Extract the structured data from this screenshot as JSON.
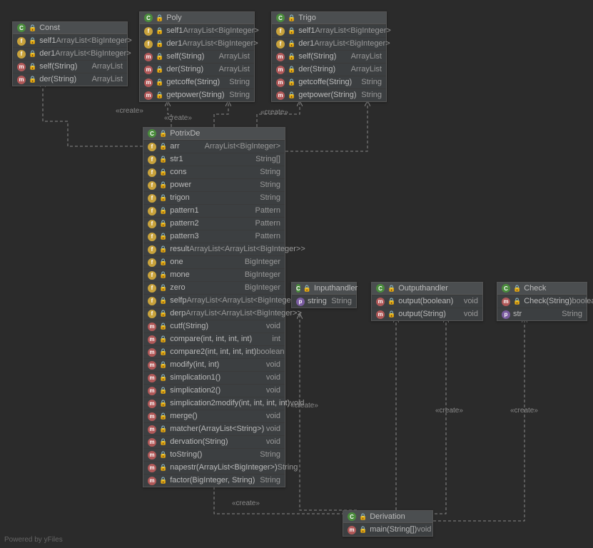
{
  "labels": {
    "create": "«create»"
  },
  "footer": "Powered by yFiles",
  "const": {
    "name": "Const",
    "fields": [
      {
        "n": "self1",
        "t": "ArrayList<BigInteger>"
      },
      {
        "n": "der1",
        "t": "ArrayList<BigInteger>"
      }
    ],
    "methods": [
      {
        "n": "self(String)",
        "t": "ArrayList"
      },
      {
        "n": "der(String)",
        "t": "ArrayList"
      }
    ]
  },
  "poly": {
    "name": "Poly",
    "fields": [
      {
        "n": "self1",
        "t": "ArrayList<BigInteger>"
      },
      {
        "n": "der1",
        "t": "ArrayList<BigInteger>"
      }
    ],
    "methods": [
      {
        "n": "self(String)",
        "t": "ArrayList"
      },
      {
        "n": "der(String)",
        "t": "ArrayList"
      },
      {
        "n": "getcoffe(String)",
        "t": "String"
      },
      {
        "n": "getpower(String)",
        "t": "String"
      }
    ]
  },
  "trigo": {
    "name": "Trigo",
    "fields": [
      {
        "n": "self1",
        "t": "ArrayList<BigInteger>"
      },
      {
        "n": "der1",
        "t": "ArrayList<BigInteger>"
      }
    ],
    "methods": [
      {
        "n": "self(String)",
        "t": "ArrayList"
      },
      {
        "n": "der(String)",
        "t": "ArrayList"
      },
      {
        "n": "getcoffe(String)",
        "t": "String"
      },
      {
        "n": "getpower(String)",
        "t": "String"
      }
    ]
  },
  "potrix": {
    "name": "PotrixDe",
    "fields": [
      {
        "k": "f",
        "n": "arr",
        "t": "ArrayList<BigInteger>"
      },
      {
        "k": "f",
        "n": "str1",
        "t": "String[]"
      },
      {
        "k": "f",
        "n": "cons",
        "t": "String"
      },
      {
        "k": "f",
        "n": "power",
        "t": "String"
      },
      {
        "k": "f",
        "n": "trigon",
        "t": "String"
      },
      {
        "k": "f",
        "n": "pattern1",
        "t": "Pattern"
      },
      {
        "k": "f",
        "n": "pattern2",
        "t": "Pattern"
      },
      {
        "k": "f",
        "n": "pattern3",
        "t": "Pattern"
      },
      {
        "k": "f",
        "n": "result",
        "t": "ArrayList<ArrayList<BigInteger>>"
      },
      {
        "k": "f",
        "n": "one",
        "t": "BigInteger"
      },
      {
        "k": "f",
        "n": "mone",
        "t": "BigInteger"
      },
      {
        "k": "f",
        "n": "zero",
        "t": "BigInteger"
      },
      {
        "k": "f",
        "n": "selfp",
        "t": "ArrayList<ArrayList<BigInteger>>"
      },
      {
        "k": "f",
        "n": "derp",
        "t": "ArrayList<ArrayList<BigInteger>>"
      }
    ],
    "methods": [
      {
        "n": "cutf(String)",
        "t": "void"
      },
      {
        "n": "compare(int, int, int, int)",
        "t": "int"
      },
      {
        "n": "compare2(int, int, int, int)",
        "t": "boolean"
      },
      {
        "n": "modify(int, int)",
        "t": "void"
      },
      {
        "n": "simplication1()",
        "t": "void"
      },
      {
        "n": "simplication2()",
        "t": "void"
      },
      {
        "n": "simplication2modify(int, int, int, int)",
        "t": "void"
      },
      {
        "n": "merge()",
        "t": "void"
      },
      {
        "n": "matcher(ArrayList<String>)",
        "t": "void"
      },
      {
        "n": "dervation(String)",
        "t": "void"
      },
      {
        "n": "toString()",
        "t": "String"
      },
      {
        "n": "napestr(ArrayList<BigInteger>)",
        "t": "String"
      },
      {
        "n": "factor(BigInteger, String)",
        "t": "String"
      }
    ]
  },
  "input": {
    "name": "Inputhandler",
    "fields": [
      {
        "n": "string",
        "t": "String"
      }
    ]
  },
  "output": {
    "name": "Outputhandler",
    "methods": [
      {
        "n": "output(boolean)",
        "t": "void"
      },
      {
        "n": "output(String)",
        "t": "void"
      }
    ]
  },
  "check": {
    "name": "Check",
    "methods": [
      {
        "n": "Check(String)",
        "t": "boolean"
      }
    ],
    "fields": [
      {
        "n": "str",
        "t": "String"
      }
    ]
  },
  "deriv": {
    "name": "Derivation",
    "methods": [
      {
        "n": "main(String[])",
        "t": "void"
      }
    ]
  }
}
